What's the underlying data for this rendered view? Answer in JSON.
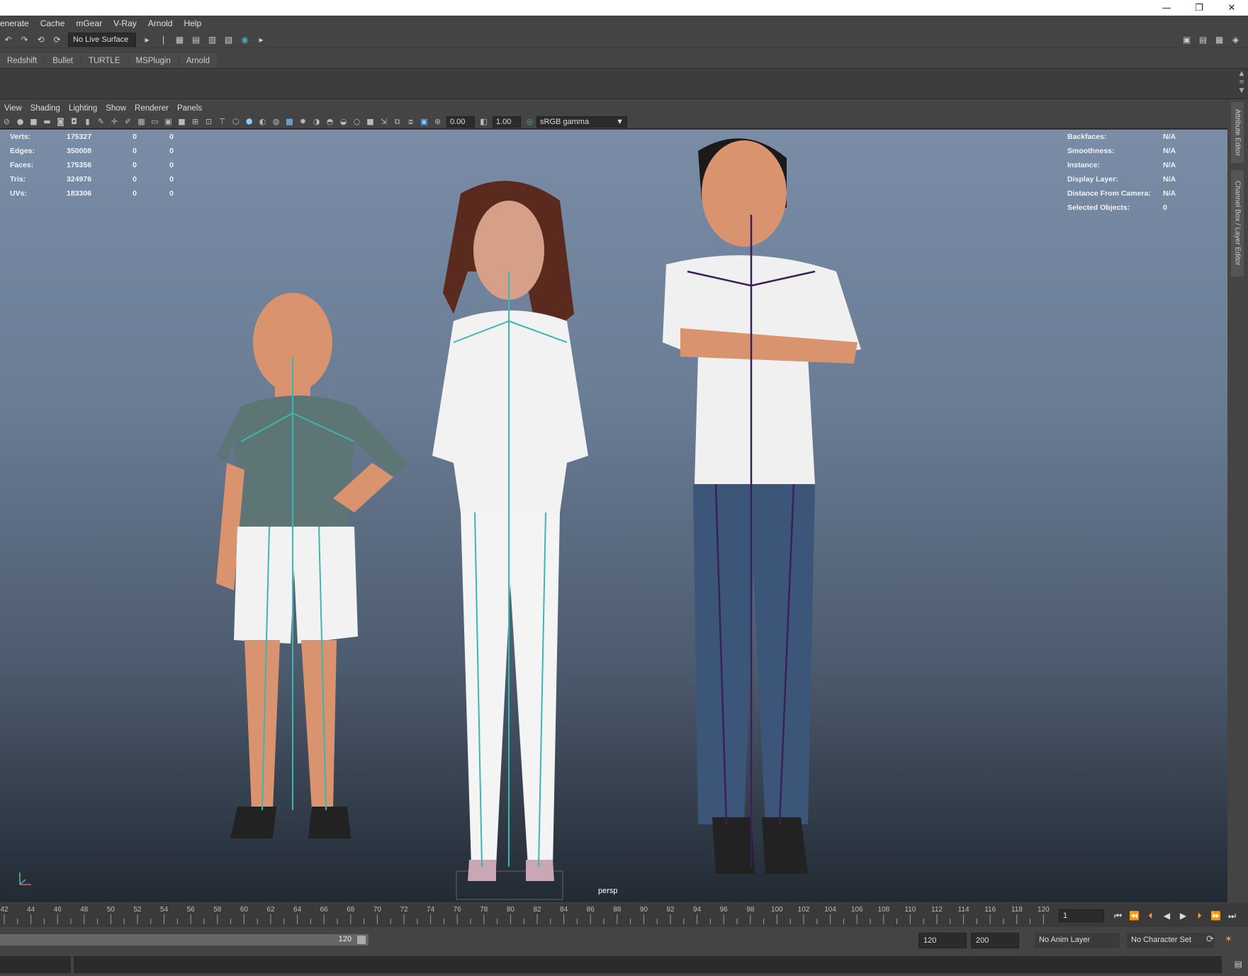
{
  "window": {
    "controls": {
      "minimize": "—",
      "restore": "❐",
      "close": "✕"
    }
  },
  "menubar": {
    "items": [
      "enerate",
      "Cache",
      "mGear",
      "V-Ray",
      "Arnold",
      "Help"
    ]
  },
  "statusline": {
    "live_surface": "No Live Surface"
  },
  "shelf_tabs": [
    "Redshift",
    "Bullet",
    "TURTLE",
    "MSPlugin",
    "Arnold"
  ],
  "panel": {
    "menu": [
      "View",
      "Shading",
      "Lighting",
      "Show",
      "Renderer",
      "Panels"
    ],
    "exposure": "0.00",
    "gamma": "1.00",
    "color_space": "sRGB gamma"
  },
  "hud_left": {
    "rows": [
      {
        "label": "Verts:",
        "v1": "175327",
        "v2": "0",
        "v3": "0"
      },
      {
        "label": "Edges:",
        "v1": "350008",
        "v2": "0",
        "v3": "0"
      },
      {
        "label": "Faces:",
        "v1": "175356",
        "v2": "0",
        "v3": "0"
      },
      {
        "label": "Tris:",
        "v1": "324976",
        "v2": "0",
        "v3": "0"
      },
      {
        "label": "UVs:",
        "v1": "183306",
        "v2": "0",
        "v3": "0"
      }
    ]
  },
  "hud_right": {
    "rows": [
      {
        "label": "Backfaces:",
        "value": "N/A"
      },
      {
        "label": "Smoothness:",
        "value": "N/A"
      },
      {
        "label": "Instance:",
        "value": "N/A"
      },
      {
        "label": "Display Layer:",
        "value": "N/A"
      },
      {
        "label": "Distance From Camera:",
        "value": "N/A"
      },
      {
        "label": "Selected Objects:",
        "value": "0"
      }
    ]
  },
  "viewport": {
    "camera": "persp"
  },
  "side_tabs": [
    "Attribute Editor",
    "Channel Box / Layer Editor"
  ],
  "timeline": {
    "tick_labels": [
      "42",
      "44",
      "46",
      "48",
      "50",
      "52",
      "54",
      "56",
      "58",
      "60",
      "62",
      "64",
      "66",
      "68",
      "70",
      "72",
      "74",
      "76",
      "78",
      "80",
      "82",
      "84",
      "86",
      "88",
      "90",
      "92",
      "94",
      "96",
      "98",
      "100",
      "102",
      "104",
      "106",
      "108",
      "110",
      "112",
      "114",
      "116",
      "118",
      "120"
    ],
    "current_frame": "1"
  },
  "range": {
    "slider_end": "120",
    "end_frame": "120",
    "max_frame": "200",
    "anim_layer": "No Anim Layer",
    "character_set": "No Character Set"
  },
  "colors": {
    "viewport_top": "#7a8ca6",
    "viewport_bottom": "#222a33",
    "ui_bg": "#444444",
    "field_bg": "#2b2b2b"
  }
}
